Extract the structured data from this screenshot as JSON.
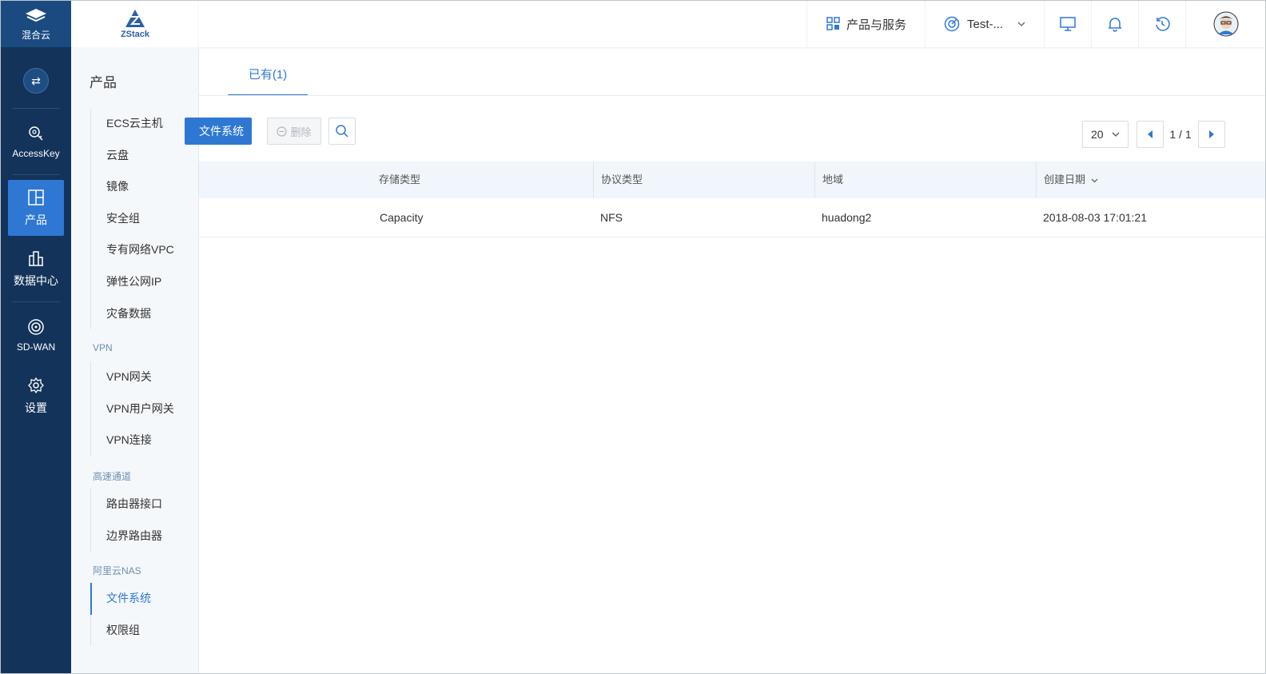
{
  "rail": {
    "brand_label": "混合云",
    "items": [
      {
        "label": "AccessKey",
        "icon": "key-icon"
      },
      {
        "label": "产品",
        "icon": "product-icon"
      },
      {
        "label": "数据中心",
        "icon": "datacenter-icon"
      },
      {
        "label": "SD-WAN",
        "icon": "sdwan-icon"
      },
      {
        "label": "设置",
        "icon": "gear-icon"
      }
    ]
  },
  "logo": {
    "text": "ZStack"
  },
  "topbar": {
    "products_services": "产品与服务",
    "account": "Test-..."
  },
  "menu": {
    "title": "产品",
    "group1": [
      "ECS云主机",
      "云盘",
      "镜像",
      "安全组",
      "专有网络VPC",
      "弹性公网IP",
      "灾备数据"
    ],
    "section_vpn": "VPN",
    "group_vpn": [
      "VPN网关",
      "VPN用户网关",
      "VPN连接"
    ],
    "section_express": "高速通道",
    "group_express": [
      "路由器接口",
      "边界路由器"
    ],
    "section_nas": "阿里云NAS",
    "group_nas": [
      "文件系统",
      "权限组"
    ],
    "active_item": "文件系统"
  },
  "main": {
    "tab_label": "已有(1)",
    "create_button": "文件系统",
    "delete_button": "删除",
    "page_size": "20",
    "page_indicator": "1 / 1",
    "columns": [
      "存储类型",
      "协议类型",
      "地域",
      "创建日期"
    ],
    "rows": [
      {
        "storage_type": "Capacity",
        "protocol": "NFS",
        "region": "huadong2",
        "created": "2018-08-03 17:01:21"
      }
    ]
  },
  "colors": {
    "accent": "#2e78d4",
    "rail": "#13335a",
    "rail_top": "#1a4a80"
  }
}
